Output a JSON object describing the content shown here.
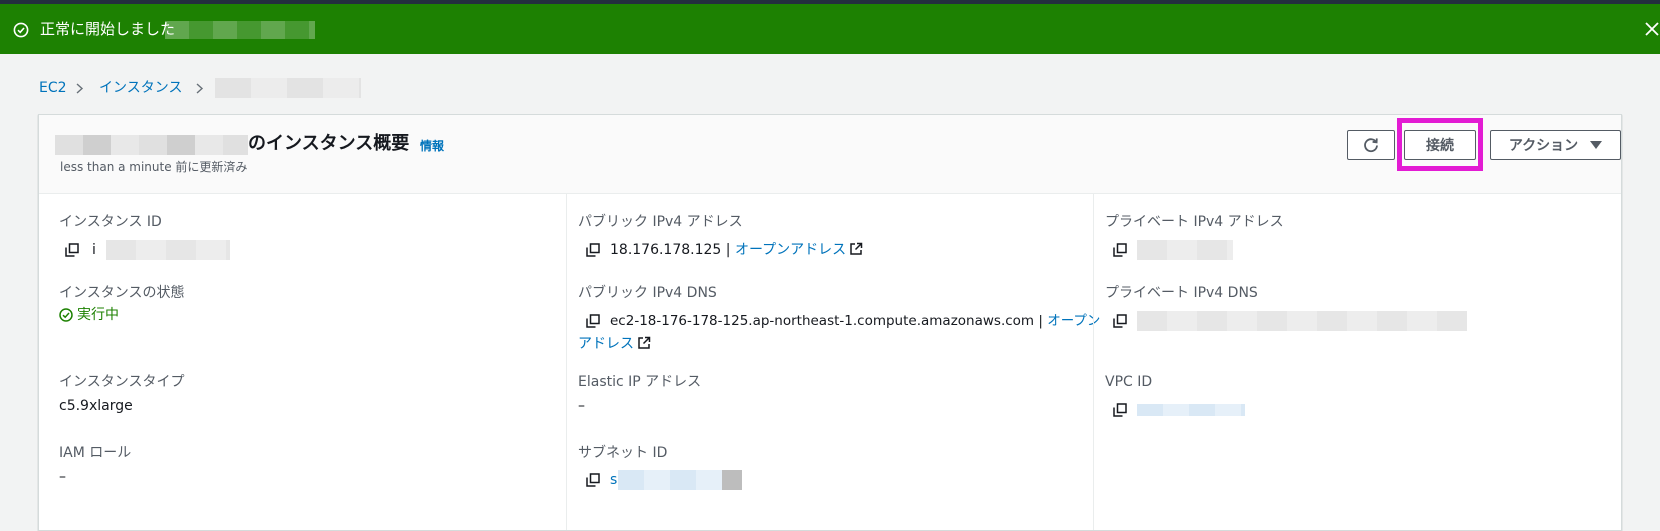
{
  "flash": {
    "message": "正常に開始しました",
    "close_label": "×"
  },
  "breadcrumb": {
    "items": [
      "EC2",
      "インスタンス"
    ]
  },
  "panel": {
    "title": "のインスタンス概要",
    "info_label": "情報",
    "updated": "less than a minute 前に更新済み",
    "buttons": {
      "connect": "接続",
      "actions": "アクション"
    }
  },
  "details": {
    "instance_id": {
      "label": "インスタンス ID",
      "value_prefix": "i"
    },
    "instance_state": {
      "label": "インスタンスの状態",
      "value": "実行中"
    },
    "instance_type": {
      "label": "インスタンスタイプ",
      "value": "c5.9xlarge"
    },
    "iam_role": {
      "label": "IAM ロール",
      "value": "–"
    },
    "public_ipv4": {
      "label": "パブリック IPv4 アドレス",
      "value": "18.176.178.125 |",
      "link": "オープンアドレス"
    },
    "public_dns": {
      "label": "パブリック IPv4 DNS",
      "value": "ec2-18-176-178-125.ap-northeast-1.compute.amazonaws.com |",
      "link_part1": "オープン",
      "link_part2": "アドレス"
    },
    "elastic_ip": {
      "label": "Elastic IP アドレス",
      "value": "–"
    },
    "subnet_id": {
      "label": "サブネット ID",
      "value_prefix": "s"
    },
    "private_ipv4": {
      "label": "プライベート IPv4 アドレス"
    },
    "private_dns": {
      "label": "プライベート IPv4 DNS"
    },
    "vpc_id": {
      "label": "VPC ID"
    }
  },
  "colors": {
    "flash_bg": "#1d8102",
    "link": "#0073bb",
    "highlight": "#e31bd3"
  }
}
